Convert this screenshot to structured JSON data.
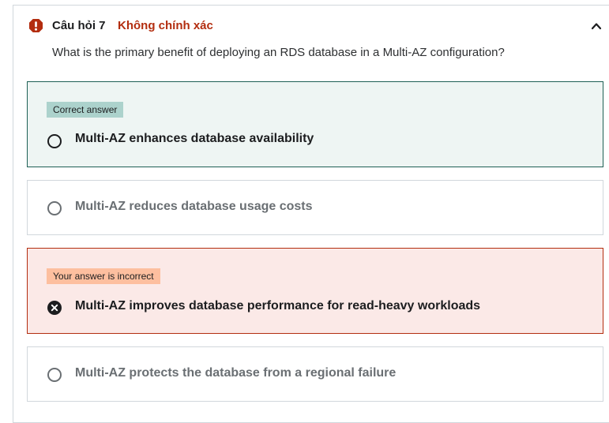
{
  "question": {
    "number_label": "Câu hỏi 7",
    "status_label": "Không chính xác",
    "text": "What is the primary benefit of deploying an RDS database in a Multi-AZ configuration?",
    "status_icon": "alert-icon",
    "collapse_icon": "chevron-up-icon"
  },
  "options": [
    {
      "label": "Multi-AZ enhances database availability",
      "badge": "Correct answer",
      "state": "correct"
    },
    {
      "label": "Multi-AZ reduces database usage costs",
      "badge": "",
      "state": "neutral"
    },
    {
      "label": "Multi-AZ improves database performance for read-heavy workloads",
      "badge": "Your answer is incorrect",
      "state": "incorrect-selected"
    },
    {
      "label": "Multi-AZ protects the database from a regional failure",
      "badge": "",
      "state": "neutral"
    }
  ],
  "colors": {
    "error": "#b32d0f",
    "correct_border": "#1e6055",
    "correct_bg": "#eef5f3",
    "correct_badge": "#acd2cc",
    "incorrect_bg": "#fbe9e7",
    "incorrect_badge": "#fdbf9f"
  }
}
